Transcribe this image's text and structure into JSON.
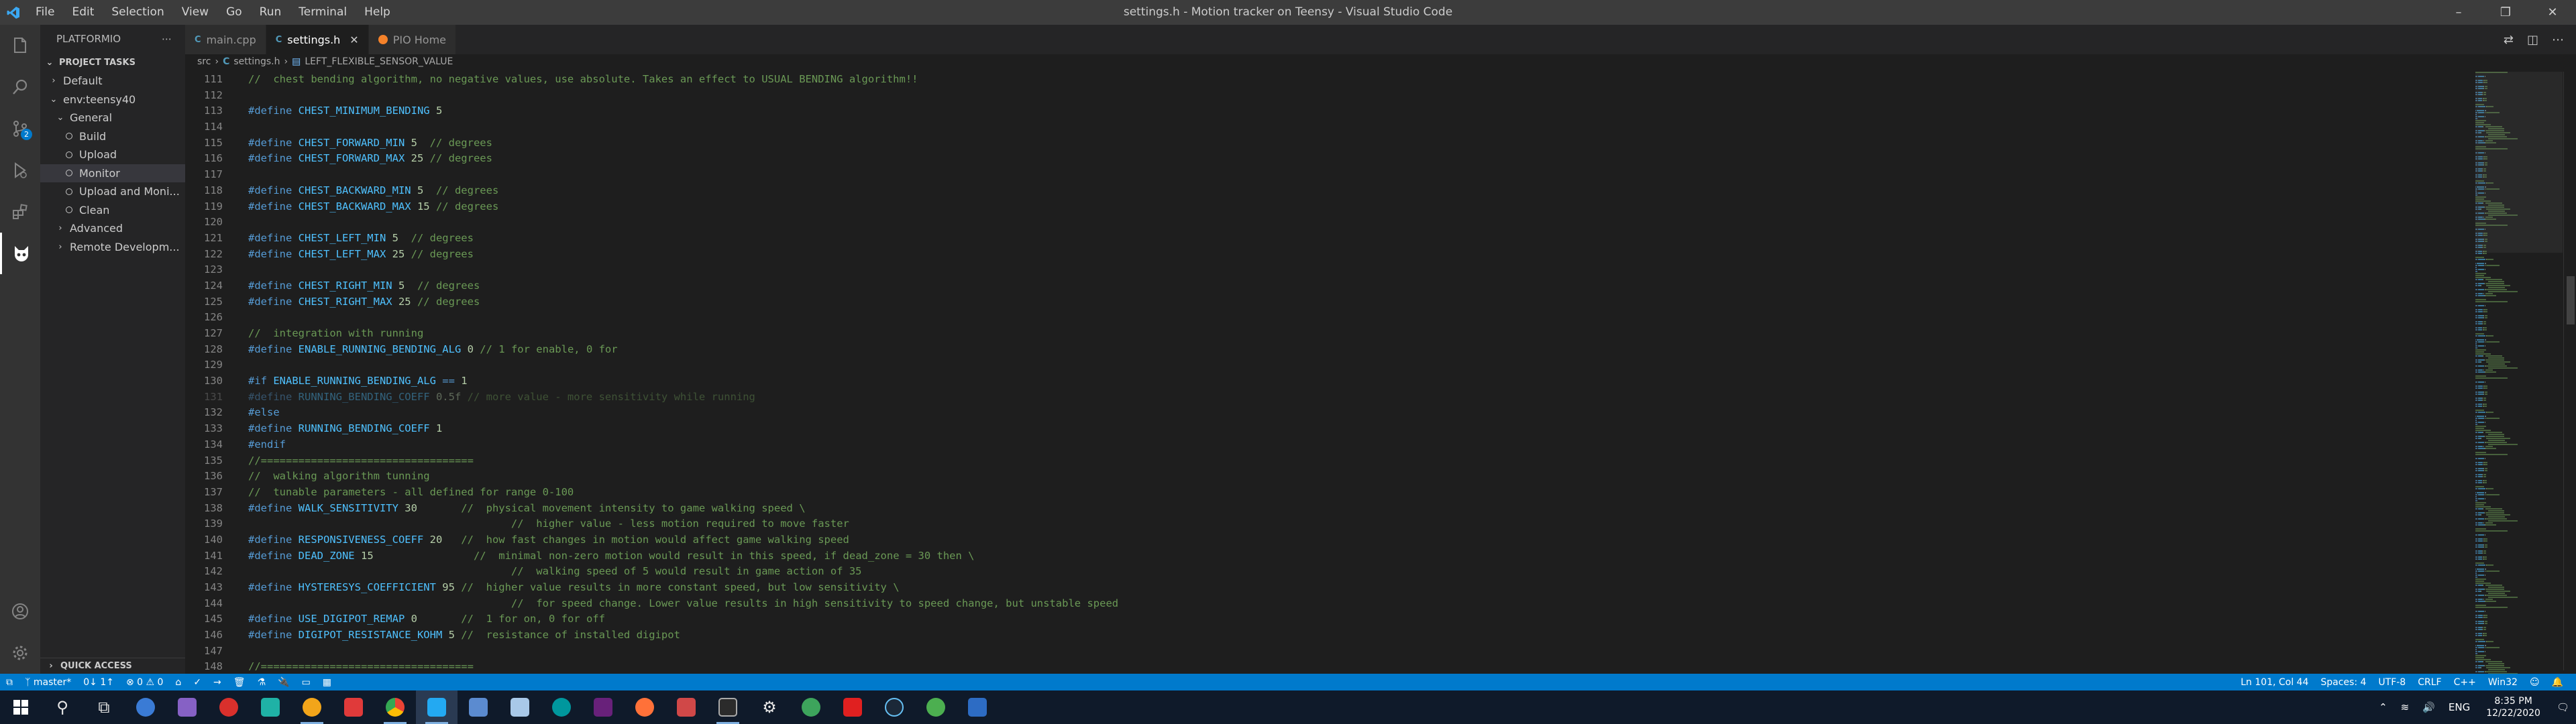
{
  "titlebar": {
    "menus": [
      "File",
      "Edit",
      "Selection",
      "View",
      "Go",
      "Run",
      "Terminal",
      "Help"
    ],
    "title": "settings.h - Motion tracker on Teensy - Visual Studio Code"
  },
  "activity": {
    "scm_badge": "2"
  },
  "sidebar": {
    "header": "PLATFORMIO",
    "section": "PROJECT TASKS",
    "items": [
      {
        "label": "Default",
        "level": 1,
        "kind": "collapsed"
      },
      {
        "label": "env:teensy40",
        "level": 1,
        "kind": "expanded"
      },
      {
        "label": "General",
        "level": 2,
        "kind": "expanded"
      },
      {
        "label": "Build",
        "level": 3,
        "kind": "task"
      },
      {
        "label": "Upload",
        "level": 3,
        "kind": "task"
      },
      {
        "label": "Monitor",
        "level": 3,
        "kind": "task",
        "selected": true
      },
      {
        "label": "Upload and Moni...",
        "level": 3,
        "kind": "task"
      },
      {
        "label": "Clean",
        "level": 3,
        "kind": "task"
      },
      {
        "label": "Advanced",
        "level": 2,
        "kind": "collapsed"
      },
      {
        "label": "Remote Developm...",
        "level": 2,
        "kind": "collapsed"
      }
    ],
    "quick_access": "QUICK ACCESS"
  },
  "tabs": [
    {
      "label": "main.cpp",
      "icon": "C",
      "active": false
    },
    {
      "label": "settings.h",
      "icon": "C",
      "active": true
    },
    {
      "label": "PIO Home",
      "icon": "pio",
      "active": false
    }
  ],
  "breadcrumb": [
    "src",
    "settings.h",
    "LEFT_FLEXIBLE_SENSOR_VALUE"
  ],
  "code": [
    {
      "n": "111",
      "t": [
        [
          "cm",
          "//  chest bending algorithm, no negative values, use absolute. Takes an effect to USUAL BENDING algorithm!!"
        ]
      ]
    },
    {
      "n": "112",
      "t": []
    },
    {
      "n": "113",
      "t": [
        [
          "pp",
          "#define "
        ],
        [
          "mac",
          "CHEST_MINIMUM_BENDING "
        ],
        [
          "num",
          "5"
        ]
      ]
    },
    {
      "n": "114",
      "t": []
    },
    {
      "n": "115",
      "t": [
        [
          "pp",
          "#define "
        ],
        [
          "mac",
          "CHEST_FORWARD_MIN "
        ],
        [
          "num",
          "5"
        ],
        [
          "cm",
          "  // degrees"
        ]
      ]
    },
    {
      "n": "116",
      "t": [
        [
          "pp",
          "#define "
        ],
        [
          "mac",
          "CHEST_FORWARD_MAX "
        ],
        [
          "num",
          "25"
        ],
        [
          "cm",
          " // degrees"
        ]
      ]
    },
    {
      "n": "117",
      "t": []
    },
    {
      "n": "118",
      "t": [
        [
          "pp",
          "#define "
        ],
        [
          "mac",
          "CHEST_BACKWARD_MIN "
        ],
        [
          "num",
          "5"
        ],
        [
          "cm",
          "  // degrees"
        ]
      ]
    },
    {
      "n": "119",
      "t": [
        [
          "pp",
          "#define "
        ],
        [
          "mac",
          "CHEST_BACKWARD_MAX "
        ],
        [
          "num",
          "15"
        ],
        [
          "cm",
          " // degrees"
        ]
      ]
    },
    {
      "n": "120",
      "t": []
    },
    {
      "n": "121",
      "t": [
        [
          "pp",
          "#define "
        ],
        [
          "mac",
          "CHEST_LEFT_MIN "
        ],
        [
          "num",
          "5"
        ],
        [
          "cm",
          "  // degrees"
        ]
      ]
    },
    {
      "n": "122",
      "t": [
        [
          "pp",
          "#define "
        ],
        [
          "mac",
          "CHEST_LEFT_MAX "
        ],
        [
          "num",
          "25"
        ],
        [
          "cm",
          " // degrees"
        ]
      ]
    },
    {
      "n": "123",
      "t": []
    },
    {
      "n": "124",
      "t": [
        [
          "pp",
          "#define "
        ],
        [
          "mac",
          "CHEST_RIGHT_MIN "
        ],
        [
          "num",
          "5"
        ],
        [
          "cm",
          "  // degrees"
        ]
      ]
    },
    {
      "n": "125",
      "t": [
        [
          "pp",
          "#define "
        ],
        [
          "mac",
          "CHEST_RIGHT_MAX "
        ],
        [
          "num",
          "25"
        ],
        [
          "cm",
          " // degrees"
        ]
      ]
    },
    {
      "n": "126",
      "t": []
    },
    {
      "n": "127",
      "t": [
        [
          "cm",
          "//  integration with running"
        ]
      ]
    },
    {
      "n": "128",
      "t": [
        [
          "pp",
          "#define "
        ],
        [
          "mac",
          "ENABLE_RUNNING_BENDING_ALG "
        ],
        [
          "num",
          "0"
        ],
        [
          "cm",
          " // 1 for enable, 0 for"
        ]
      ]
    },
    {
      "n": "129",
      "t": []
    },
    {
      "n": "130",
      "t": [
        [
          "pp",
          "#if "
        ],
        [
          "mac",
          "ENABLE_RUNNING_BENDING_ALG "
        ],
        [
          "pp",
          "== "
        ],
        [
          "num",
          "1"
        ]
      ]
    },
    {
      "n": "131",
      "dim": true,
      "t": [
        [
          "pp",
          "#define "
        ],
        [
          "mac",
          "RUNNING_BENDING_COEFF "
        ],
        [
          "num",
          "0.5f"
        ],
        [
          "cm",
          " // more value - more sensitivity while running"
        ]
      ]
    },
    {
      "n": "132",
      "t": [
        [
          "pp",
          "#else"
        ]
      ]
    },
    {
      "n": "133",
      "t": [
        [
          "pp",
          "#define "
        ],
        [
          "mac",
          "RUNNING_BENDING_COEFF "
        ],
        [
          "num",
          "1"
        ]
      ]
    },
    {
      "n": "134",
      "t": [
        [
          "pp",
          "#endif"
        ]
      ]
    },
    {
      "n": "135",
      "t": [
        [
          "cm",
          "//=================================="
        ]
      ]
    },
    {
      "n": "136",
      "t": [
        [
          "cm",
          "//  walking algorithm tunning"
        ]
      ]
    },
    {
      "n": "137",
      "t": [
        [
          "cm",
          "//  tunable parameters - all defined for range 0-100"
        ]
      ]
    },
    {
      "n": "138",
      "t": [
        [
          "pp",
          "#define "
        ],
        [
          "mac",
          "WALK_SENSITIVITY "
        ],
        [
          "num",
          "30"
        ],
        [
          "cm",
          "       //  physical movement intensity to game walking speed \\"
        ]
      ]
    },
    {
      "n": "139",
      "t": [
        [
          "cm",
          "                                          //  higher value - less motion required to move faster"
        ]
      ]
    },
    {
      "n": "140",
      "t": [
        [
          "pp",
          "#define "
        ],
        [
          "mac",
          "RESPONSIVENESS_COEFF "
        ],
        [
          "num",
          "20"
        ],
        [
          "cm",
          "   //  how fast changes in motion would affect game walking speed"
        ]
      ]
    },
    {
      "n": "141",
      "t": [
        [
          "pp",
          "#define "
        ],
        [
          "mac",
          "DEAD_ZONE "
        ],
        [
          "num",
          "15"
        ],
        [
          "cm",
          "                //  minimal non-zero motion would result in this speed, if dead_zone = 30 then \\"
        ]
      ]
    },
    {
      "n": "142",
      "t": [
        [
          "cm",
          "                                          //  walking speed of 5 would result in game action of 35"
        ]
      ]
    },
    {
      "n": "143",
      "t": [
        [
          "pp",
          "#define "
        ],
        [
          "mac",
          "HYSTERESYS_COEFFICIENT "
        ],
        [
          "num",
          "95"
        ],
        [
          "cm",
          " //  higher value results in more constant speed, but low sensitivity \\"
        ]
      ]
    },
    {
      "n": "144",
      "t": [
        [
          "cm",
          "                                          //  for speed change. Lower value results in high sensitivity to speed change, but unstable speed"
        ]
      ]
    },
    {
      "n": "145",
      "t": [
        [
          "pp",
          "#define "
        ],
        [
          "mac",
          "USE_DIGIPOT_REMAP "
        ],
        [
          "num",
          "0"
        ],
        [
          "cm",
          "       //  1 for on, 0 for off"
        ]
      ]
    },
    {
      "n": "146",
      "t": [
        [
          "pp",
          "#define "
        ],
        [
          "mac",
          "DIGIPOT_RESISTANCE_KOHM "
        ],
        [
          "num",
          "5"
        ],
        [
          "cm",
          " //  resistance of installed digipot"
        ]
      ]
    },
    {
      "n": "147",
      "t": []
    },
    {
      "n": "148",
      "t": [
        [
          "cm",
          "//=================================="
        ]
      ]
    }
  ],
  "statusbar": {
    "branch": "master*",
    "sync": "0↓ 1↑",
    "problems": "⊗ 0 ⚠ 0",
    "cursor": "Ln 101, Col 44",
    "spaces": "Spaces: 4",
    "encoding": "UTF-8",
    "eol": "CRLF",
    "language": "C++",
    "platform": "Win32"
  },
  "taskbar": {
    "language": "ENG",
    "time": "8:35 PM",
    "date": "12/22/2020"
  },
  "colors": {
    "accent": "#007acc",
    "comment": "#6a9955",
    "keyword": "#569cd6",
    "macro": "#4fc1ff",
    "number": "#b5cea8"
  }
}
